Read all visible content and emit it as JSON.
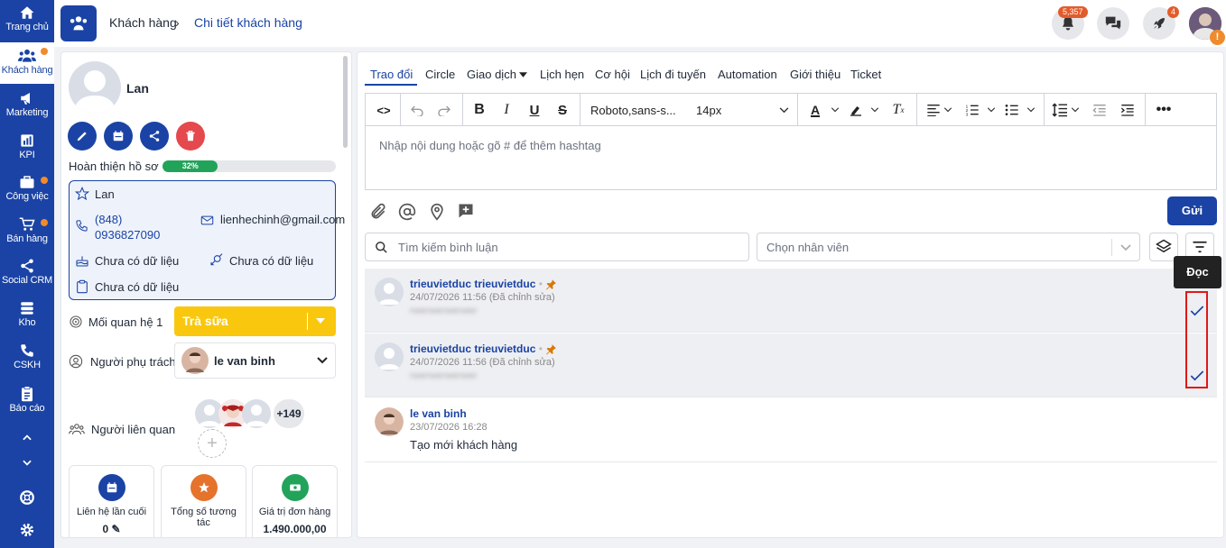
{
  "sidebar": {
    "items": [
      {
        "label": "Trang chủ",
        "icon": "home-icon",
        "dot": false
      },
      {
        "label": "Khách hàng",
        "icon": "users-icon",
        "dot": true
      },
      {
        "label": "Marketing",
        "icon": "megaphone-icon",
        "dot": false
      },
      {
        "label": "KPI",
        "icon": "chart-icon",
        "dot": false
      },
      {
        "label": "Công việc",
        "icon": "briefcase-icon",
        "dot": true
      },
      {
        "label": "Bán hàng",
        "icon": "cart-icon",
        "dot": true
      },
      {
        "label": "Social CRM",
        "icon": "share-icon",
        "dot": false
      },
      {
        "label": "Kho",
        "icon": "warehouse-icon",
        "dot": false
      },
      {
        "label": "CSKH",
        "icon": "phone-icon",
        "dot": false
      },
      {
        "label": "Báo cáo",
        "icon": "clipboard-icon",
        "dot": false
      }
    ]
  },
  "header": {
    "breadcrumb_parent": "Khách hàng",
    "breadcrumb_current": "Chi tiết khách hàng",
    "notifications_badge": "5,357",
    "rocket_badge": "4"
  },
  "profile": {
    "name": "Lan",
    "completion_label": "Hoàn thiện hồ sơ",
    "completion_percent_text": "32%",
    "completion_fraction": 0.32,
    "card": {
      "name": "Lan",
      "phone": "(848) 0936827090",
      "email": "lienhechinh@gmail.com",
      "birthday": "Chưa có dữ liệu",
      "gender": "Chưa có dữ liệu",
      "note": "Chưa có dữ liệu"
    },
    "relationship_label": "Mối quan hệ 1",
    "relationship_value": "Trà sữa",
    "owner_label": "Người phụ trách",
    "owner_value": "le van binh",
    "related_label": "Người liên quan",
    "related_more": "+149",
    "stats": [
      {
        "label": "Liên hệ lần cuối",
        "value": "0"
      },
      {
        "label": "Tổng số tương tác",
        "value": ""
      },
      {
        "label": "Giá trị đơn hàng",
        "value": "1.490.000,00"
      }
    ]
  },
  "tabs": [
    "Trao đổi",
    "Circle",
    "Giao dịch",
    "Lịch hẹn",
    "Cơ hội",
    "Lịch đi tuyến",
    "Automation",
    "Giới thiệu",
    "Ticket"
  ],
  "editor": {
    "font": "Roboto,sans-s...",
    "size": "14px",
    "placeholder": "Nhập nội dung hoặc gõ # để thêm hashtag",
    "send_label": "Gửi"
  },
  "filters": {
    "search_placeholder": "Tìm kiếm bình luận",
    "staff_placeholder": "Chọn nhân viên"
  },
  "comments": [
    {
      "author": "trieuvietduc trieuvietduc",
      "time": "24/07/2026 11:56 (Đã chỉnh sửa)",
      "text": "rwerwerwerwer",
      "pinned": true,
      "read": true
    },
    {
      "author": "trieuvietduc trieuvietduc",
      "time": "24/07/2026 11:56 (Đã chỉnh sửa)",
      "text": "rwerwerwerwer",
      "pinned": true,
      "read": true
    },
    {
      "author": "le van binh",
      "time": "23/07/2026 16:28",
      "text": "Tạo mới khách hàng",
      "pinned": false,
      "read": false
    }
  ],
  "tooltip": "Đọc",
  "colors": {
    "primary": "#1a43a5",
    "accent_orange": "#f08b2d",
    "green": "#22a35a",
    "red": "#e5484d",
    "yellow": "#f9c80e"
  }
}
